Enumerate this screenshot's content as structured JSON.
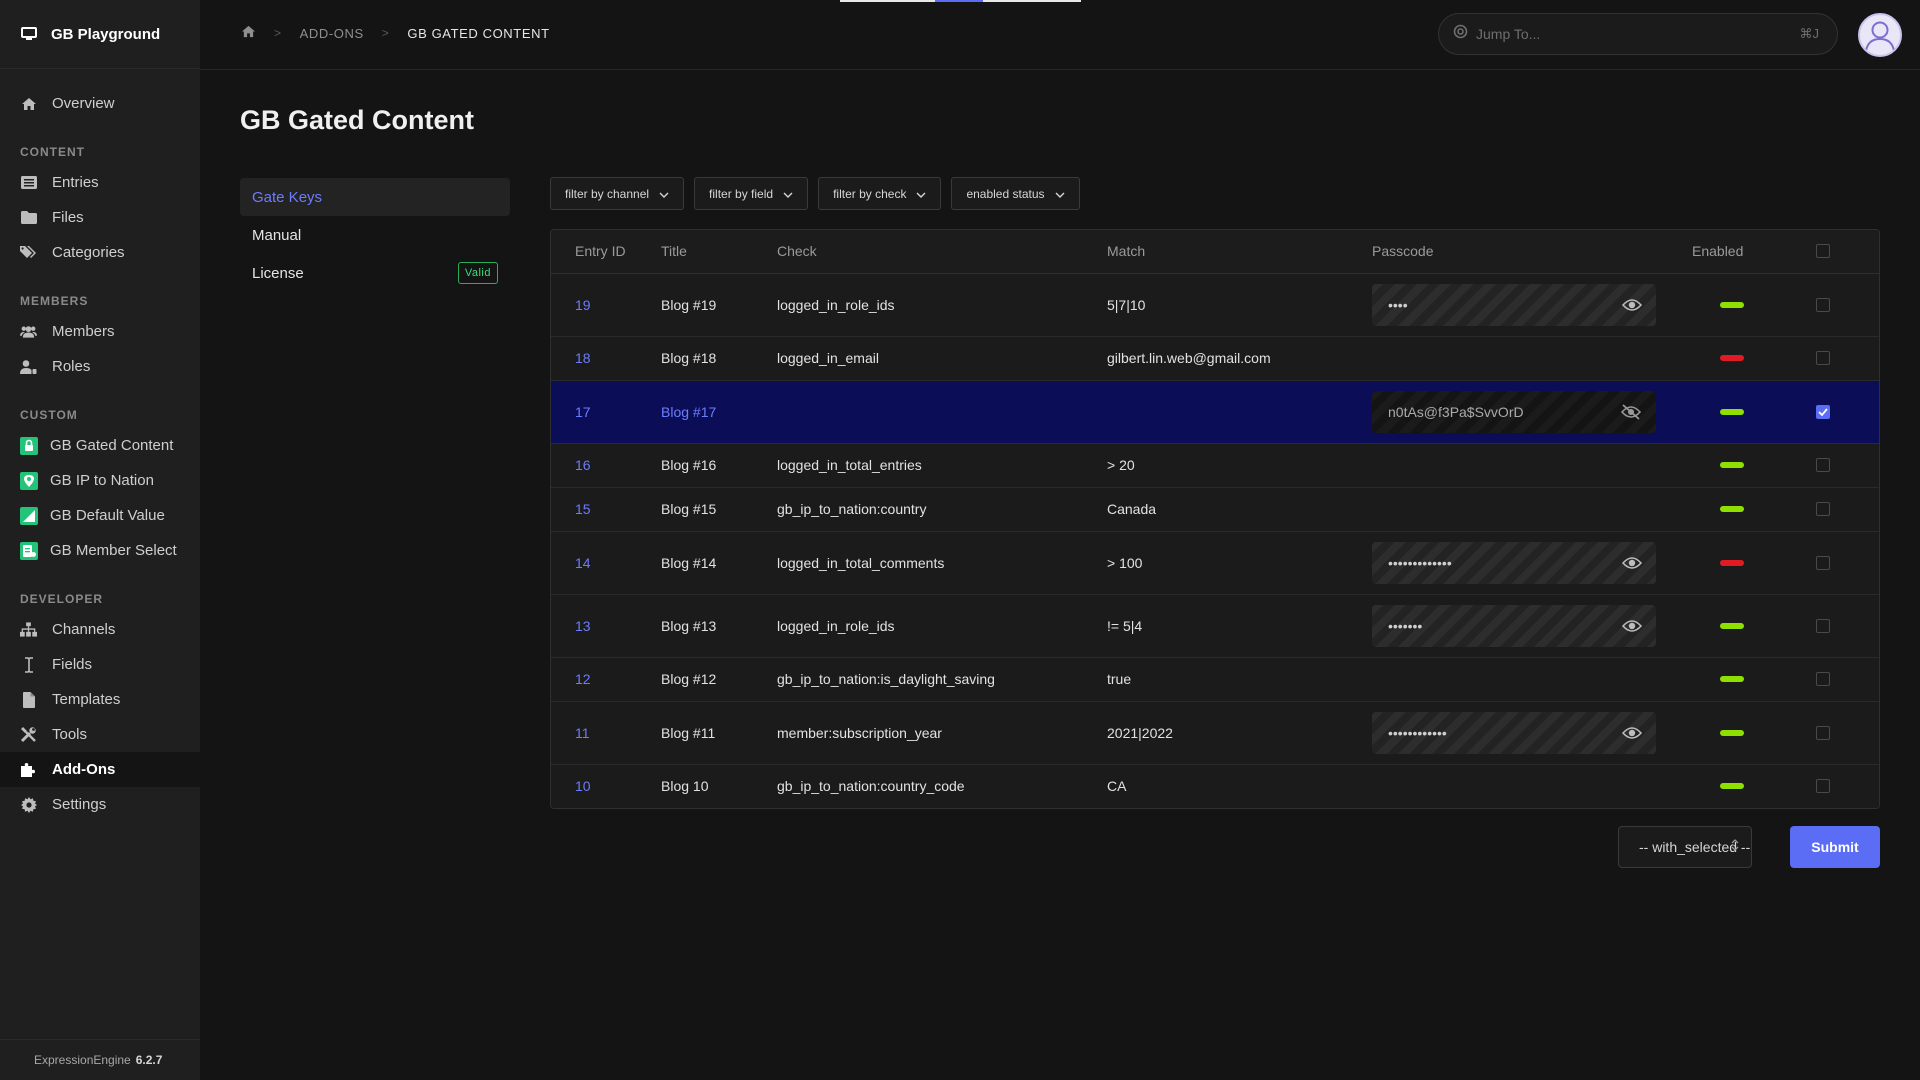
{
  "brand": {
    "name": "GB Playground",
    "icon": "monitor-icon"
  },
  "sidebar": {
    "top_items": [
      {
        "label": "Overview",
        "icon": "home-icon"
      }
    ],
    "sections": [
      {
        "title": "CONTENT",
        "items": [
          {
            "label": "Entries",
            "icon": "entries-icon"
          },
          {
            "label": "Files",
            "icon": "folder-icon"
          },
          {
            "label": "Categories",
            "icon": "tags-icon"
          }
        ]
      },
      {
        "title": "MEMBERS",
        "items": [
          {
            "label": "Members",
            "icon": "users-icon"
          },
          {
            "label": "Roles",
            "icon": "user-roles-icon"
          }
        ]
      },
      {
        "title": "CUSTOM",
        "items": [
          {
            "label": "GB Gated Content",
            "icon": "gated-content-icon"
          },
          {
            "label": "GB IP to Nation",
            "icon": "map-pin-icon"
          },
          {
            "label": "GB Default Value",
            "icon": "default-value-icon"
          },
          {
            "label": "GB Member Select",
            "icon": "member-select-icon"
          }
        ]
      },
      {
        "title": "DEVELOPER",
        "items": [
          {
            "label": "Channels",
            "icon": "sitemap-icon"
          },
          {
            "label": "Fields",
            "icon": "i-cursor-icon"
          },
          {
            "label": "Templates",
            "icon": "file-icon"
          },
          {
            "label": "Tools",
            "icon": "tools-icon"
          },
          {
            "label": "Add-Ons",
            "icon": "puzzle-icon"
          },
          {
            "label": "Settings",
            "icon": "gear-icon"
          }
        ]
      }
    ],
    "footer": {
      "product": "ExpressionEngine",
      "version": "6.2.7"
    }
  },
  "breadcrumb": {
    "home_icon": "home-icon",
    "sep": ">",
    "level1": "ADD-ONS",
    "level2": "GB GATED CONTENT"
  },
  "jump": {
    "placeholder": "Jump To...",
    "shortcut": "⌘J"
  },
  "page_title": "GB Gated Content",
  "subnav": {
    "gate_keys": "Gate Keys",
    "manual": "Manual",
    "license": "License",
    "license_badge": "Valid"
  },
  "filters": [
    "filter by channel",
    "filter by field",
    "filter by check",
    "enabled status"
  ],
  "table": {
    "headers": {
      "entry_id": "Entry ID",
      "title": "Title",
      "check": "Check",
      "match": "Match",
      "passcode": "Passcode",
      "enabled": "Enabled"
    },
    "rows": [
      {
        "id": "19",
        "title": "Blog #19",
        "check": "logged_in_role_ids",
        "match": "5|7|10",
        "passcode": "••••",
        "enabled": true,
        "checked": false
      },
      {
        "id": "18",
        "title": "Blog #18",
        "check": "logged_in_email",
        "match": "gilbert.lin.web@gmail.com",
        "passcode": "",
        "enabled": false,
        "checked": false
      },
      {
        "id": "17",
        "title": "Blog #17",
        "check": "",
        "match": "",
        "passcode": "n0tAs@f3Pa$SvvOrD",
        "enabled": true,
        "checked": true,
        "selected": true,
        "revealed": true
      },
      {
        "id": "16",
        "title": "Blog #16",
        "check": "logged_in_total_entries",
        "match": "> 20",
        "passcode": "",
        "enabled": true,
        "checked": false
      },
      {
        "id": "15",
        "title": "Blog #15",
        "check": "gb_ip_to_nation:country",
        "match": "Canada",
        "passcode": "",
        "enabled": true,
        "checked": false
      },
      {
        "id": "14",
        "title": "Blog #14",
        "check": "logged_in_total_comments",
        "match": "> 100",
        "passcode": "•••••••••••••",
        "enabled": false,
        "checked": false
      },
      {
        "id": "13",
        "title": "Blog #13",
        "check": "logged_in_role_ids",
        "match": "!= 5|4",
        "passcode": "•••••••",
        "enabled": true,
        "checked": false
      },
      {
        "id": "12",
        "title": "Blog #12",
        "check": "gb_ip_to_nation:is_daylight_saving",
        "match": "true",
        "passcode": "",
        "enabled": true,
        "checked": false
      },
      {
        "id": "11",
        "title": "Blog #11",
        "check": "member:subscription_year",
        "match": "2021|2022",
        "passcode": "••••••••••••",
        "enabled": true,
        "checked": false
      },
      {
        "id": "10",
        "title": "Blog 10",
        "check": "gb_ip_to_nation:country_code",
        "match": "CA",
        "passcode": "",
        "enabled": true,
        "checked": false
      }
    ]
  },
  "bulk_action": {
    "value": "-- with_selected --"
  },
  "submit_label": "Submit",
  "colors": {
    "accent": "#5b6cf5",
    "enabled": "#8fe000",
    "disabled": "#e01b24",
    "valid": "#3ddc7c"
  }
}
